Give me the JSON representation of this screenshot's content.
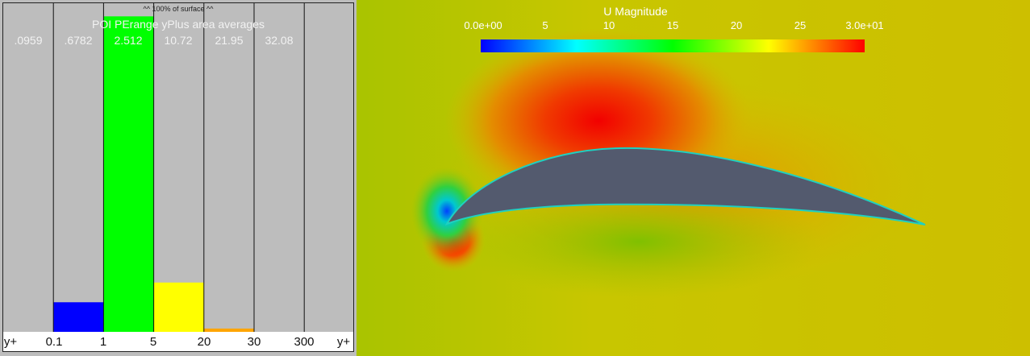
{
  "chart_data": {
    "type": "bar",
    "title": "POI PErange yPlus area averages",
    "note": "^^ 100% of surface ^^",
    "x_ticks": [
      "y+",
      "0.1",
      "1",
      "5",
      "20",
      "30",
      "300",
      "y+"
    ],
    "bins": [
      "<0.1",
      "0.1-1",
      "1-5",
      "5-20",
      "20-30",
      "30-300",
      ">300"
    ],
    "averages": [
      ".0959",
      ".6782",
      "2.512",
      "10.72",
      "21.95",
      "32.08",
      ""
    ],
    "values": [
      0,
      9,
      96,
      15,
      1,
      0,
      0
    ],
    "ylim": [
      0,
      100
    ],
    "colors": [
      "#0000ff",
      "#0000ff",
      "#00ff00",
      "#ffff00",
      "#ffa500",
      "#ff0000",
      "#ff0000"
    ]
  },
  "colorbar": {
    "title": "U Magnitude",
    "labels": [
      "0.0e+00",
      "5",
      "10",
      "15",
      "20",
      "25",
      "3.0e+01"
    ],
    "range": [
      0,
      30
    ],
    "colors": [
      "#0000ff",
      "#00ffff",
      "#00ff00",
      "#ffff00",
      "#ff0000"
    ]
  }
}
